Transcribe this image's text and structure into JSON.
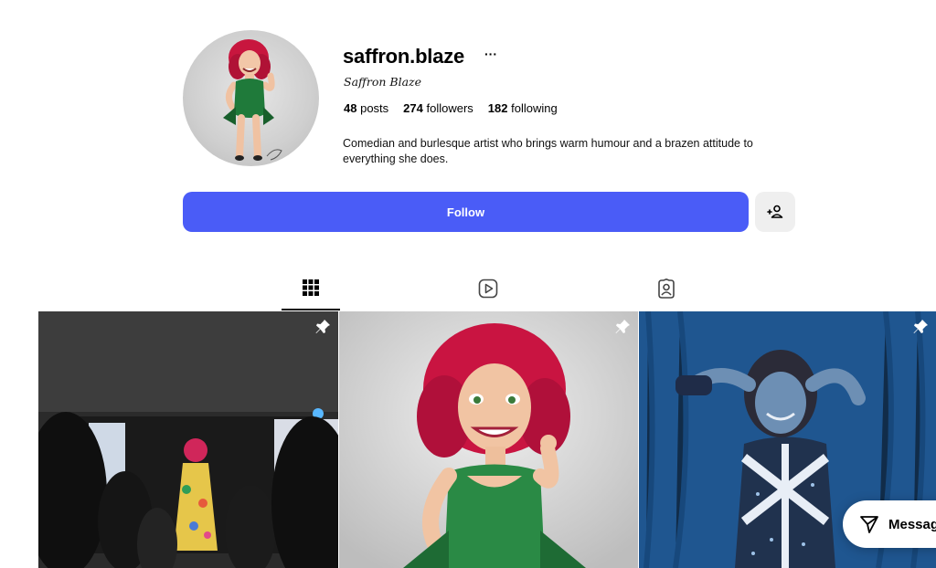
{
  "profile": {
    "username": "saffron.blaze",
    "more_label": "···",
    "full_name": "Saffron Blaze",
    "stats": {
      "posts_count": "48",
      "posts_label": "posts",
      "followers_count": "274",
      "followers_label": "followers",
      "following_count": "182",
      "following_label": "following"
    },
    "bio": "Comedian and burlesque artist who brings warm humour and a brazen attitude to everything she does."
  },
  "actions": {
    "follow_label": "Follow",
    "suggest_icon": "add-person-icon"
  },
  "tabs": [
    {
      "icon": "grid-icon",
      "active": true
    },
    {
      "icon": "reels-icon",
      "active": false
    },
    {
      "icon": "tagged-icon",
      "active": false
    }
  ],
  "posts": [
    {
      "pinned": true,
      "icon": "pin-icon"
    },
    {
      "pinned": true,
      "icon": "pin-icon"
    },
    {
      "pinned": true,
      "icon": "pin-icon"
    }
  ],
  "message_button": {
    "label": "Message",
    "icon": "send-icon"
  },
  "colors": {
    "accent": "#4a5cf7",
    "secondary_button": "#efefef"
  }
}
